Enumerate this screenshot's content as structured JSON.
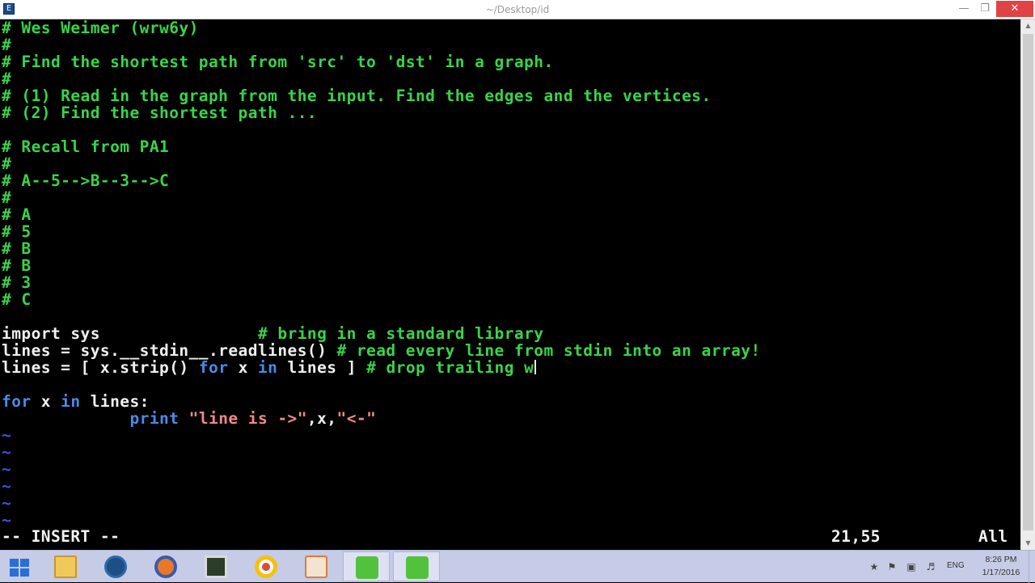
{
  "window": {
    "title": "~/Desktop/id"
  },
  "editor": {
    "lines": [
      [
        [
          "c",
          "# Wes Weimer (wrw6y)"
        ]
      ],
      [
        [
          "c",
          "#"
        ]
      ],
      [
        [
          "c",
          "# Find the shortest path from 'src' to 'dst' in a graph."
        ]
      ],
      [
        [
          "c",
          "#"
        ]
      ],
      [
        [
          "c",
          "# (1) Read in the graph from the input. Find the edges and the vertices."
        ]
      ],
      [
        [
          "c",
          "# (2) Find the shortest path ..."
        ]
      ],
      [],
      [
        [
          "c",
          "# Recall from PA1"
        ]
      ],
      [
        [
          "c",
          "#"
        ]
      ],
      [
        [
          "c",
          "# A--5-->B--3-->C"
        ]
      ],
      [
        [
          "c",
          "#"
        ]
      ],
      [
        [
          "c",
          "# A"
        ]
      ],
      [
        [
          "c",
          "# 5"
        ]
      ],
      [
        [
          "c",
          "# B"
        ]
      ],
      [
        [
          "c",
          "# B"
        ]
      ],
      [
        [
          "c",
          "# 3"
        ]
      ],
      [
        [
          "c",
          "# C"
        ]
      ],
      [],
      [
        [
          "w",
          "import sys                "
        ],
        [
          "c",
          "# bring in a standard library"
        ]
      ],
      [
        [
          "w",
          "lines = sys.__stdin__.readlines() "
        ],
        [
          "c",
          "# read every line from stdin into an array!"
        ]
      ],
      [
        [
          "w",
          "lines = [ x.strip() "
        ],
        [
          "k",
          "for"
        ],
        [
          "w",
          " x "
        ],
        [
          "k",
          "in"
        ],
        [
          "w",
          " lines ] "
        ],
        [
          "c",
          "# drop trailing w"
        ]
      ],
      [],
      [
        [
          "k",
          "for"
        ],
        [
          "w",
          " x "
        ],
        [
          "k",
          "in"
        ],
        [
          "w",
          " lines:"
        ]
      ],
      [
        [
          "w",
          "             "
        ],
        [
          "k",
          "print"
        ],
        [
          "w",
          " "
        ],
        [
          "s",
          "\"line is ->\""
        ],
        [
          "w",
          ",x,"
        ],
        [
          "s",
          "\"<-\""
        ]
      ],
      [
        [
          "t",
          "~"
        ]
      ],
      [
        [
          "t",
          "~"
        ]
      ],
      [
        [
          "t",
          "~"
        ]
      ],
      [
        [
          "t",
          "~"
        ]
      ],
      [
        [
          "t",
          "~"
        ]
      ],
      [
        [
          "t",
          "~"
        ]
      ]
    ],
    "cursor_line": 20
  },
  "status": {
    "mode": "-- INSERT --",
    "position": "21,55",
    "scroll": "All"
  },
  "taskbar": {
    "apps": [
      "start-icon",
      "file-explorer-icon",
      "steam-icon",
      "firefox-icon",
      "terminal-icon",
      "chrome-icon",
      "paint-icon",
      "cygwin-icon",
      "cygwin-icon"
    ],
    "language": "ENG",
    "time": "8:26 PM",
    "date": "1/17/2016"
  },
  "colors": {
    "comment": "#39d44a",
    "code": "#f0f0f0",
    "keyword": "#4a8ae8",
    "string": "#f08a8a",
    "tilde": "#3a56e0",
    "close": "#e04343",
    "taskbar": "#c6cbe6"
  }
}
